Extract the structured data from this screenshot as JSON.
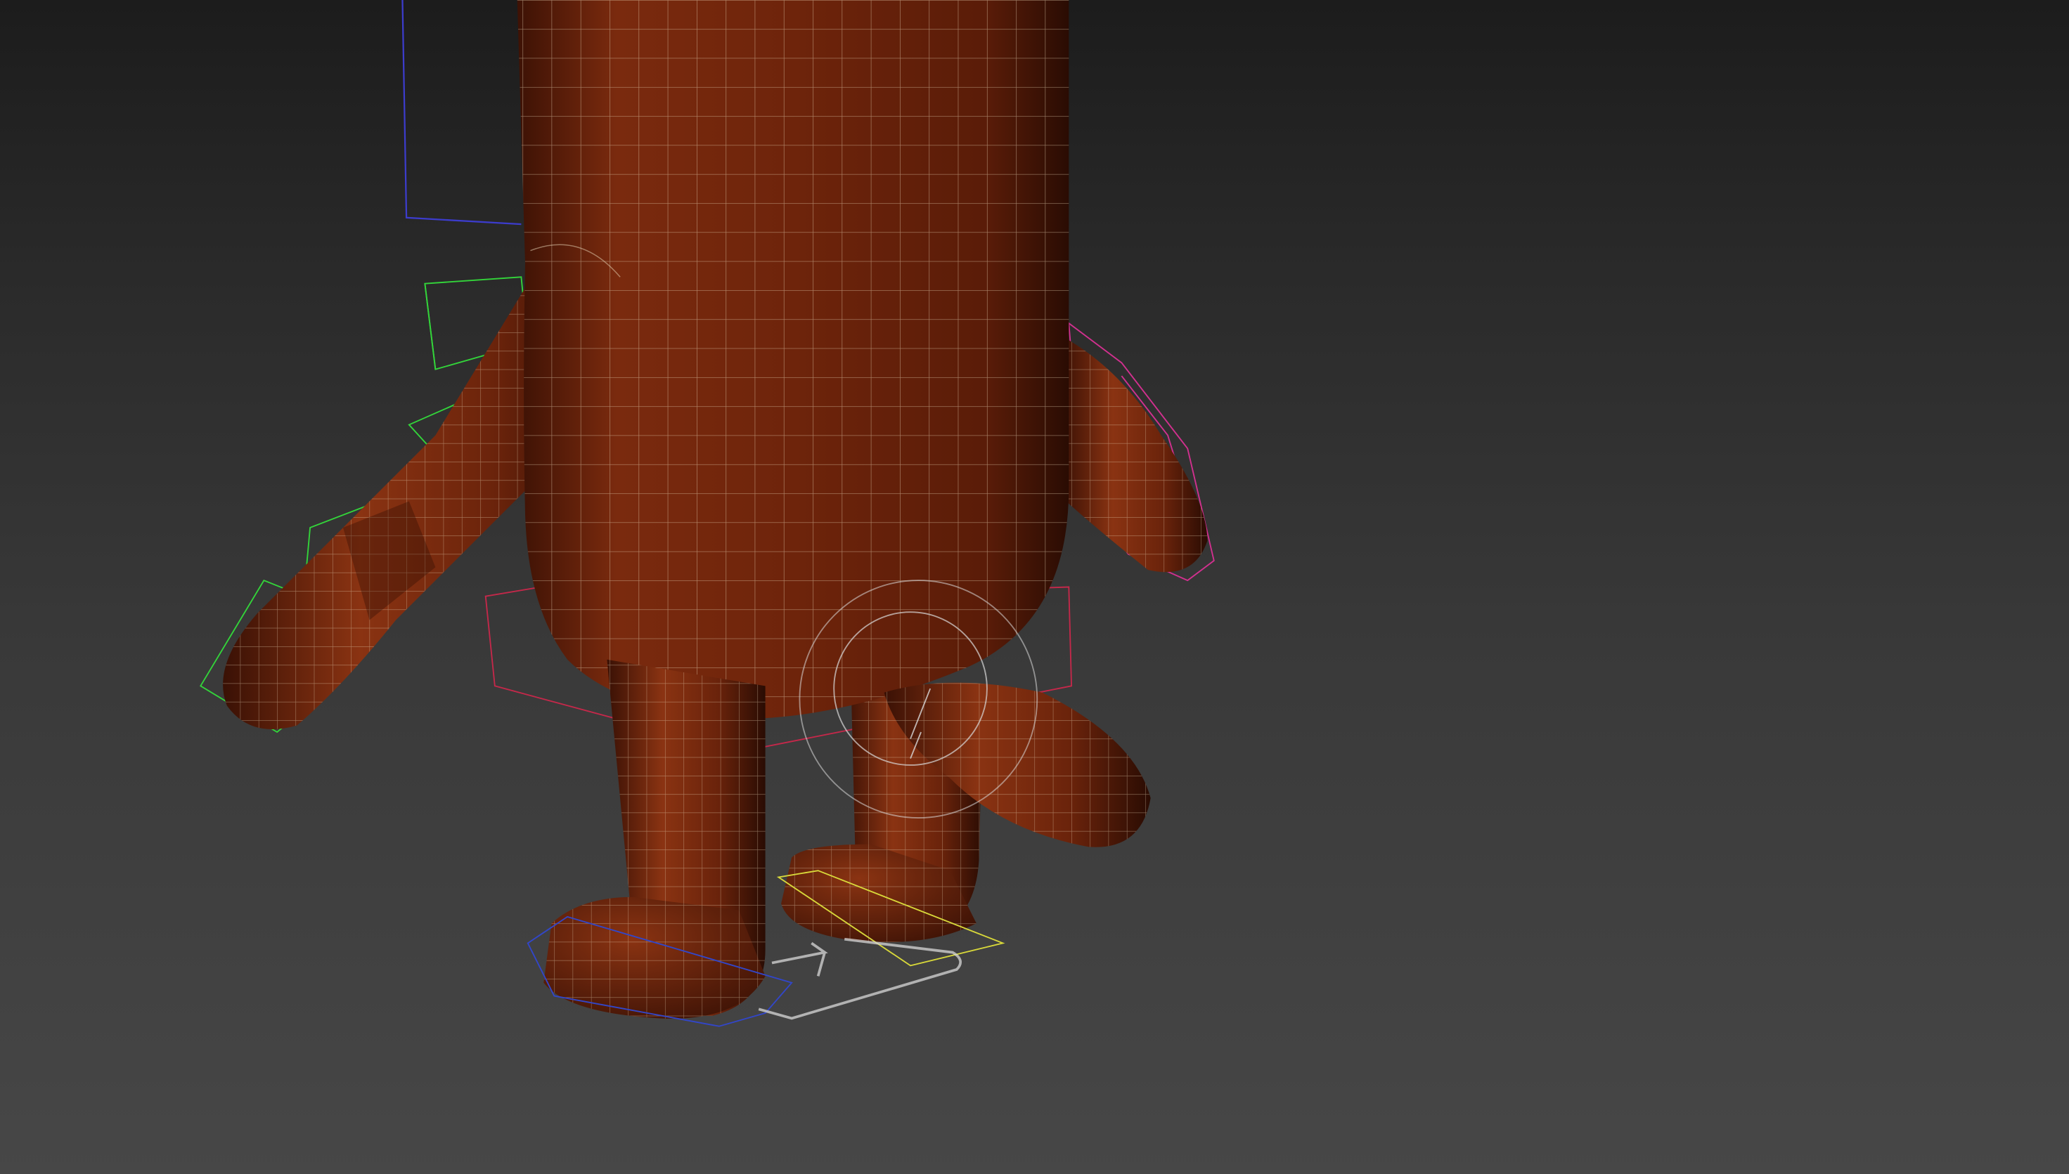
{
  "viewport": {
    "background_top": "#1c1c1c",
    "background_bottom": "#474747",
    "view_mode": "perspective-shaded-wireframe"
  },
  "model": {
    "subject": "cartoon-character-rig",
    "surface_color": "#7a2a0e",
    "highlight_color": "#a8441a",
    "shadow_color": "#2a0c03",
    "wire_color": "#e8d6b8"
  },
  "rig_controls": {
    "left_arm_color": "#33d43a",
    "right_arm_color": "#d2308f",
    "spine_color": "#3c3ccc",
    "hip_color": "#c4284a",
    "foot_left_color": "#3246c8",
    "foot_right_color": "#d8d83a",
    "gizmo_color": "#d8d8d8"
  }
}
